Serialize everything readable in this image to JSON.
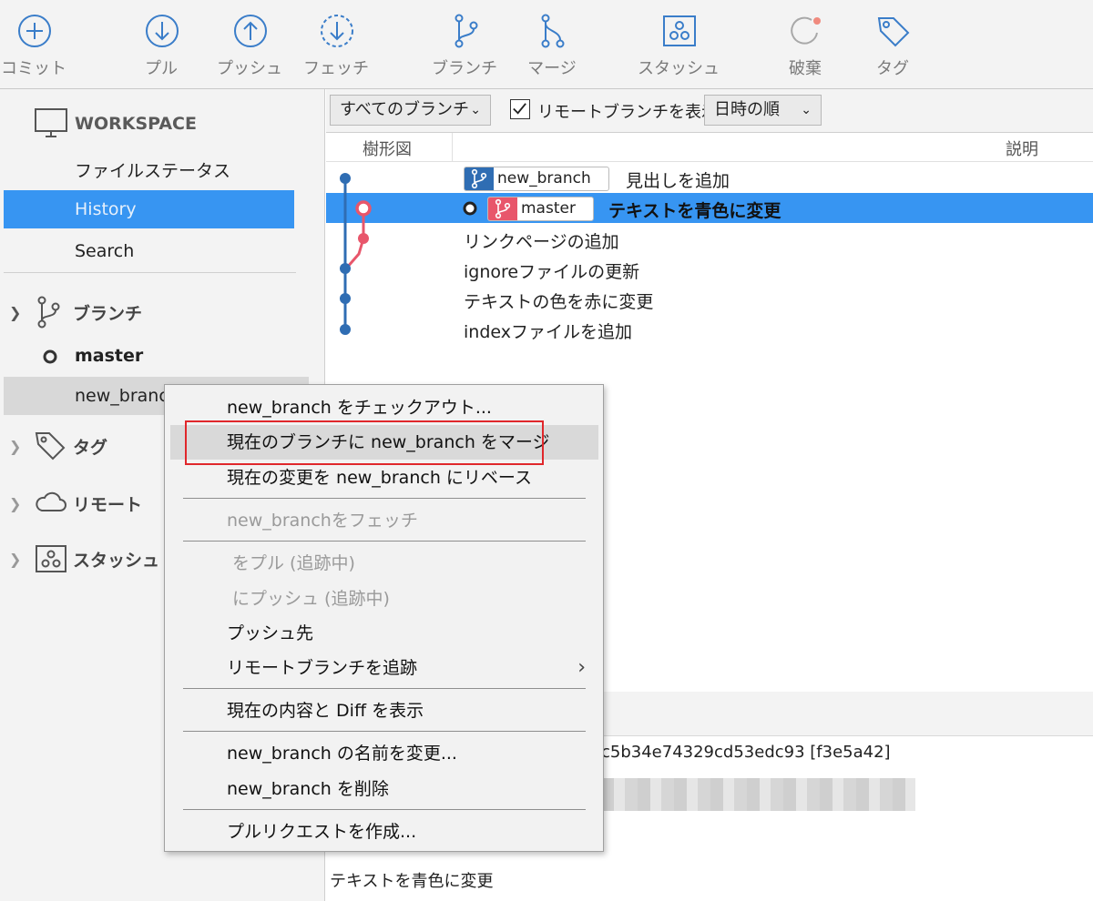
{
  "toolbar": {
    "commit": "コミット",
    "pull": "プル",
    "push": "プッシュ",
    "fetch": "フェッチ",
    "branch": "ブランチ",
    "merge": "マージ",
    "stash": "スタッシュ",
    "discard": "破棄",
    "tag": "タグ"
  },
  "sidebar": {
    "workspace": "WORKSPACE",
    "items": [
      "ファイルステータス",
      "History",
      "Search"
    ],
    "branches_label": "ブランチ",
    "branches": [
      "master",
      "new_branch"
    ],
    "tags_label": "タグ",
    "remote_label": "リモート",
    "stash_label": "スタッシュ"
  },
  "filter": {
    "branch_select": "すべてのブランチ",
    "show_remote": "リモートブランチを表示",
    "sort_select": "日時の順"
  },
  "columns": {
    "graph": "樹形図",
    "description": "説明"
  },
  "commits": [
    {
      "tag": "new_branch",
      "message": "見出しを追加"
    },
    {
      "tag": "master",
      "message": "テキストを青色に変更"
    },
    {
      "message": "リンクページの追加"
    },
    {
      "message": "ignoreファイルの更新"
    },
    {
      "message": "テキストの色を赤に変更"
    },
    {
      "message": "indexファイルを追加"
    }
  ],
  "colors": {
    "accent": "#3795f2",
    "branch_blue": "#2f6db3",
    "branch_red": "#e8566b",
    "highlight": "#e0272b"
  },
  "details": {
    "hash_fragment": "c5b34e74329cd53edc93 [f3e5a42]",
    "message": "テキストを青色に変更"
  },
  "context_menu": {
    "items": [
      "new_branch をチェックアウト...",
      "現在のブランチに new_branch をマージ",
      "現在の変更を new_branch にリベース",
      "new_branchをフェッチ",
      "をプル (追跡中)",
      "にプッシュ (追跡中)",
      "プッシュ先",
      "リモートブランチを追跡",
      "現在の内容と Diff を表示",
      "new_branch の名前を変更...",
      "new_branch を削除",
      "プルリクエストを作成..."
    ]
  }
}
